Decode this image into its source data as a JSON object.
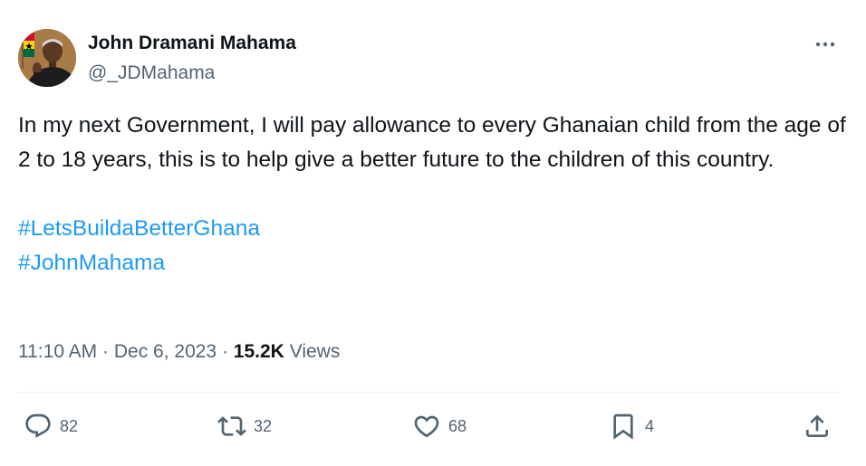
{
  "author": {
    "name": "John Dramani Mahama",
    "handle": "@_JDMahama"
  },
  "tweet": {
    "text_line": "In my next Government, I will pay allowance to every Ghanaian child from the age of 2 to 18 years, this is to help give a better future to the children of this country.",
    "hashtags": [
      "#LetsBuildaBetterGhana",
      "#JohnMahama"
    ]
  },
  "meta": {
    "time": "11:10 AM",
    "date": "Dec 6, 2023",
    "separator": "·",
    "views_count": "15.2K",
    "views_label": "Views"
  },
  "actions": {
    "replies": "82",
    "reposts": "32",
    "likes": "68",
    "bookmarks": "4"
  },
  "icons": {
    "more": "more-horizontal-icon",
    "reply": "reply-icon",
    "repost": "repost-icon",
    "like": "heart-icon",
    "bookmark": "bookmark-icon",
    "share": "share-icon"
  },
  "colors": {
    "text": "#0f1419",
    "secondary": "#536471",
    "link": "#1d9bf0",
    "divider": "#eff3f4"
  }
}
